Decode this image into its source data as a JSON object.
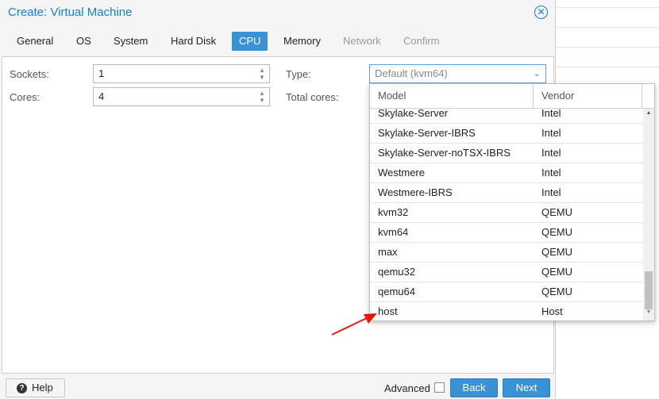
{
  "window": {
    "title": "Create: Virtual Machine",
    "close_symbol": "✕"
  },
  "tabs": [
    {
      "label": "General",
      "state": "normal"
    },
    {
      "label": "OS",
      "state": "normal"
    },
    {
      "label": "System",
      "state": "normal"
    },
    {
      "label": "Hard Disk",
      "state": "normal"
    },
    {
      "label": "CPU",
      "state": "active"
    },
    {
      "label": "Memory",
      "state": "normal"
    },
    {
      "label": "Network",
      "state": "disabled"
    },
    {
      "label": "Confirm",
      "state": "disabled"
    }
  ],
  "form": {
    "sockets_label": "Sockets:",
    "sockets_value": "1",
    "cores_label": "Cores:",
    "cores_value": "4",
    "type_label": "Type:",
    "type_value": "Default (kvm64)",
    "total_cores_label": "Total cores:"
  },
  "dropdown": {
    "col_model": "Model",
    "col_vendor": "Vendor",
    "rows": [
      {
        "model": "Skylake-Server",
        "vendor": "Intel"
      },
      {
        "model": "Skylake-Server-IBRS",
        "vendor": "Intel"
      },
      {
        "model": "Skylake-Server-noTSX-IBRS",
        "vendor": "Intel"
      },
      {
        "model": "Westmere",
        "vendor": "Intel"
      },
      {
        "model": "Westmere-IBRS",
        "vendor": "Intel"
      },
      {
        "model": "kvm32",
        "vendor": "QEMU"
      },
      {
        "model": "kvm64",
        "vendor": "QEMU"
      },
      {
        "model": "max",
        "vendor": "QEMU"
      },
      {
        "model": "qemu32",
        "vendor": "QEMU"
      },
      {
        "model": "qemu64",
        "vendor": "QEMU"
      },
      {
        "model": "host",
        "vendor": "Host"
      }
    ]
  },
  "footer": {
    "help_label": "Help",
    "advanced_label": "Advanced",
    "back_label": "Back",
    "next_label": "Next"
  },
  "colors": {
    "accent": "#3892d4",
    "title": "#157fcc",
    "annotation_arrow": "#e8160c"
  },
  "icons": {
    "close": "close-icon",
    "help": "question-circle-icon",
    "combo": "chevron-down-icon",
    "annotation": "red-arrow-icon"
  }
}
